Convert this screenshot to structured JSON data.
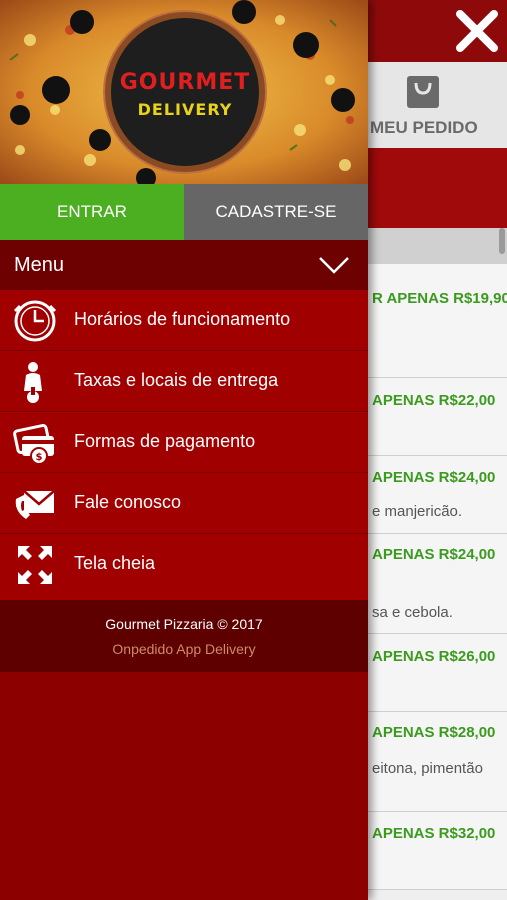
{
  "topbar": {
    "close_icon": "close-x-icon"
  },
  "tab": {
    "label": "MEU PEDIDO",
    "icon": "shopping-bag-icon"
  },
  "background_rows": [
    {
      "price": "R APENAS R$19,90",
      "desc": ""
    },
    {
      "price": "APENAS R$22,00",
      "desc": ""
    },
    {
      "price": "APENAS R$24,00",
      "desc": "e manjericão."
    },
    {
      "price": "APENAS R$24,00",
      "desc": "sa e cebola."
    },
    {
      "price": "APENAS R$26,00",
      "desc": ""
    },
    {
      "price": "APENAS R$28,00",
      "desc": "eitona, pimentão"
    },
    {
      "price": "APENAS R$32,00",
      "desc": ""
    }
  ],
  "logo": {
    "line1": "GOURMET",
    "line2": "DELIVERY"
  },
  "auth": {
    "login_label": "ENTRAR",
    "signup_label": "CADASTRE-SE"
  },
  "menu": {
    "title": "Menu",
    "items": [
      {
        "label": "Horários de funcionamento",
        "icon": "clock-icon"
      },
      {
        "label": "Taxas e locais de entrega",
        "icon": "scooter-icon"
      },
      {
        "label": "Formas de pagamento",
        "icon": "payment-card-icon"
      },
      {
        "label": "Fale conosco",
        "icon": "mail-phone-icon"
      },
      {
        "label": "Tela cheia",
        "icon": "fullscreen-icon"
      }
    ]
  },
  "footer": {
    "copyright": "Gourmet Pizzaria © 2017",
    "powered_by": "Onpedido App Delivery"
  },
  "colors": {
    "primary_red": "#8c0000",
    "green": "#4caf22",
    "price_green": "#3b9a1f"
  }
}
